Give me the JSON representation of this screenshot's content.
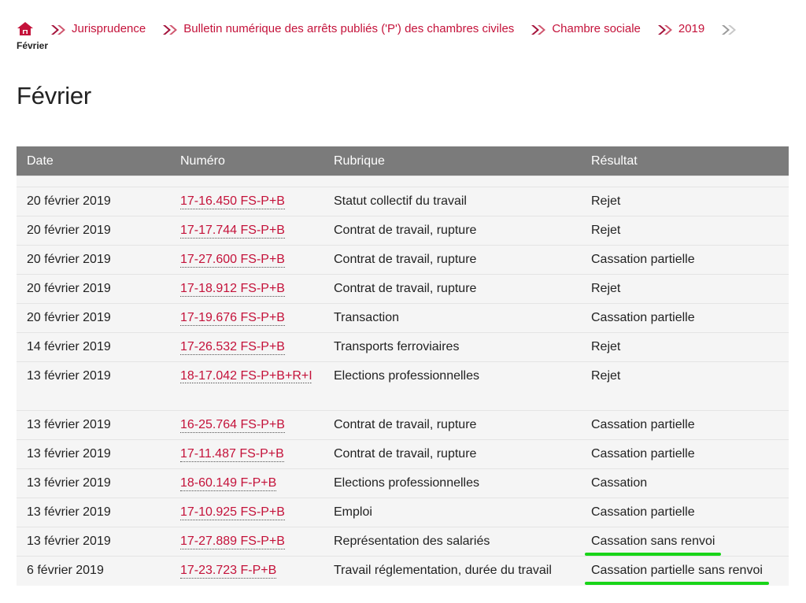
{
  "colors": {
    "link": "#c4123a",
    "header_bg": "#7b7b7b",
    "row_bg": "#f5f5f5",
    "highlight": "#19d419"
  },
  "breadcrumb": {
    "home_icon": "home-icon",
    "separator_icon": "double-chevron-right-icon",
    "items": [
      {
        "label": "Jurisprudence"
      },
      {
        "label": "Bulletin numérique des arrêts publiés ('P') des chambres civiles"
      },
      {
        "label": "Chambre sociale"
      },
      {
        "label": "2019"
      }
    ],
    "current": "Février"
  },
  "page": {
    "title": "Février"
  },
  "table": {
    "headers": {
      "date": "Date",
      "numero": "Numéro",
      "rubrique": "Rubrique",
      "resultat": "Résultat"
    },
    "rows": [
      {
        "date": "20 février 2019",
        "numero": "17-16.450 FS-P+B",
        "rubrique": "Statut collectif du travail",
        "resultat": "Rejet"
      },
      {
        "date": "20 février 2019",
        "numero": "17-17.744 FS-P+B",
        "rubrique": "Contrat de travail, rupture",
        "resultat": "Rejet"
      },
      {
        "date": "20 février 2019",
        "numero": "17-27.600 FS-P+B",
        "rubrique": "Contrat de travail, rupture",
        "resultat": "Cassation partielle"
      },
      {
        "date": "20 février 2019",
        "numero": "17-18.912 FS-P+B",
        "rubrique": "Contrat de travail, rupture",
        "resultat": "Rejet"
      },
      {
        "date": "20 février 2019",
        "numero": "17-19.676 FS-P+B",
        "rubrique": "Transaction",
        "resultat": "Cassation partielle"
      },
      {
        "date": "14 février 2019",
        "numero": "17-26.532 FS-P+B",
        "rubrique": "Transports ferroviaires",
        "resultat": "Rejet"
      },
      {
        "date": "13 février 2019",
        "numero": "18-17.042 FS-P+B+R+I",
        "rubrique": "Elections professionnelles",
        "resultat": "Rejet"
      },
      {
        "date": "13 février 2019",
        "numero": "16-25.764 FS-P+B",
        "rubrique": "Contrat de travail, rupture",
        "resultat": "Cassation partielle"
      },
      {
        "date": "13 février 2019",
        "numero": "17-11.487 FS-P+B",
        "rubrique": "Contrat de travail, rupture",
        "resultat": "Cassation partielle"
      },
      {
        "date": "13 février 2019",
        "numero": "18-60.149 F-P+B",
        "rubrique": "Elections professionnelles",
        "resultat": "Cassation"
      },
      {
        "date": "13 février 2019",
        "numero": "17-10.925 FS-P+B",
        "rubrique": "Emploi",
        "resultat": "Cassation partielle"
      },
      {
        "date": "13 février 2019",
        "numero": "17-27.889 FS-P+B",
        "rubrique": "Représentation des salariés",
        "resultat": "Cassation sans renvoi"
      },
      {
        "date": "6 février 2019",
        "numero": "17-23.723 F-P+B",
        "rubrique": "Travail réglementation, durée du travail",
        "resultat": "Cassation partielle sans renvoi"
      }
    ]
  }
}
